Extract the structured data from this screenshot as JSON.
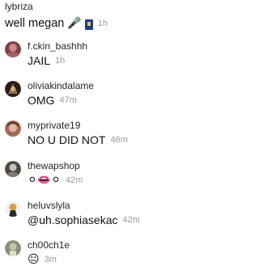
{
  "post": {
    "username": "lybriza",
    "caption": "well megan",
    "caption_emoji": "🎤",
    "caption_flag": "flag-icon",
    "time": "1h"
  },
  "comments": [
    {
      "username": "f.ckin_bashhh",
      "text": "JAIL",
      "time": "1h",
      "avatar": {
        "bg": "#7a3e4a",
        "fg": "#c98c82"
      }
    },
    {
      "username": "oliviakindalame",
      "text": "OMG",
      "time": "47m",
      "avatar": {
        "bg": "#2b1d16",
        "fg": "#a57a5a"
      }
    },
    {
      "username": "myprivate19",
      "text": "NO U DID NOT",
      "time": "46m",
      "avatar": {
        "bg": "#a26a55",
        "fg": "#e3b6a3"
      }
    },
    {
      "username": "thewapshop",
      "text": "⚪👄⚪",
      "time": "42m",
      "avatar": {
        "bg": "#4b4a47",
        "fg": "#c8c5bf"
      }
    },
    {
      "username": "heluvslyla",
      "text": "@uh.sophiasekac",
      "time": "42m",
      "avatar": {
        "bg": "#2a2a2a",
        "fg": "#d2a24a"
      }
    },
    {
      "username": "ch00ch1e",
      "text": "😐",
      "time": "3m",
      "avatar": {
        "bg": "#8a8f7e",
        "fg": "#c9c3a8"
      }
    }
  ]
}
